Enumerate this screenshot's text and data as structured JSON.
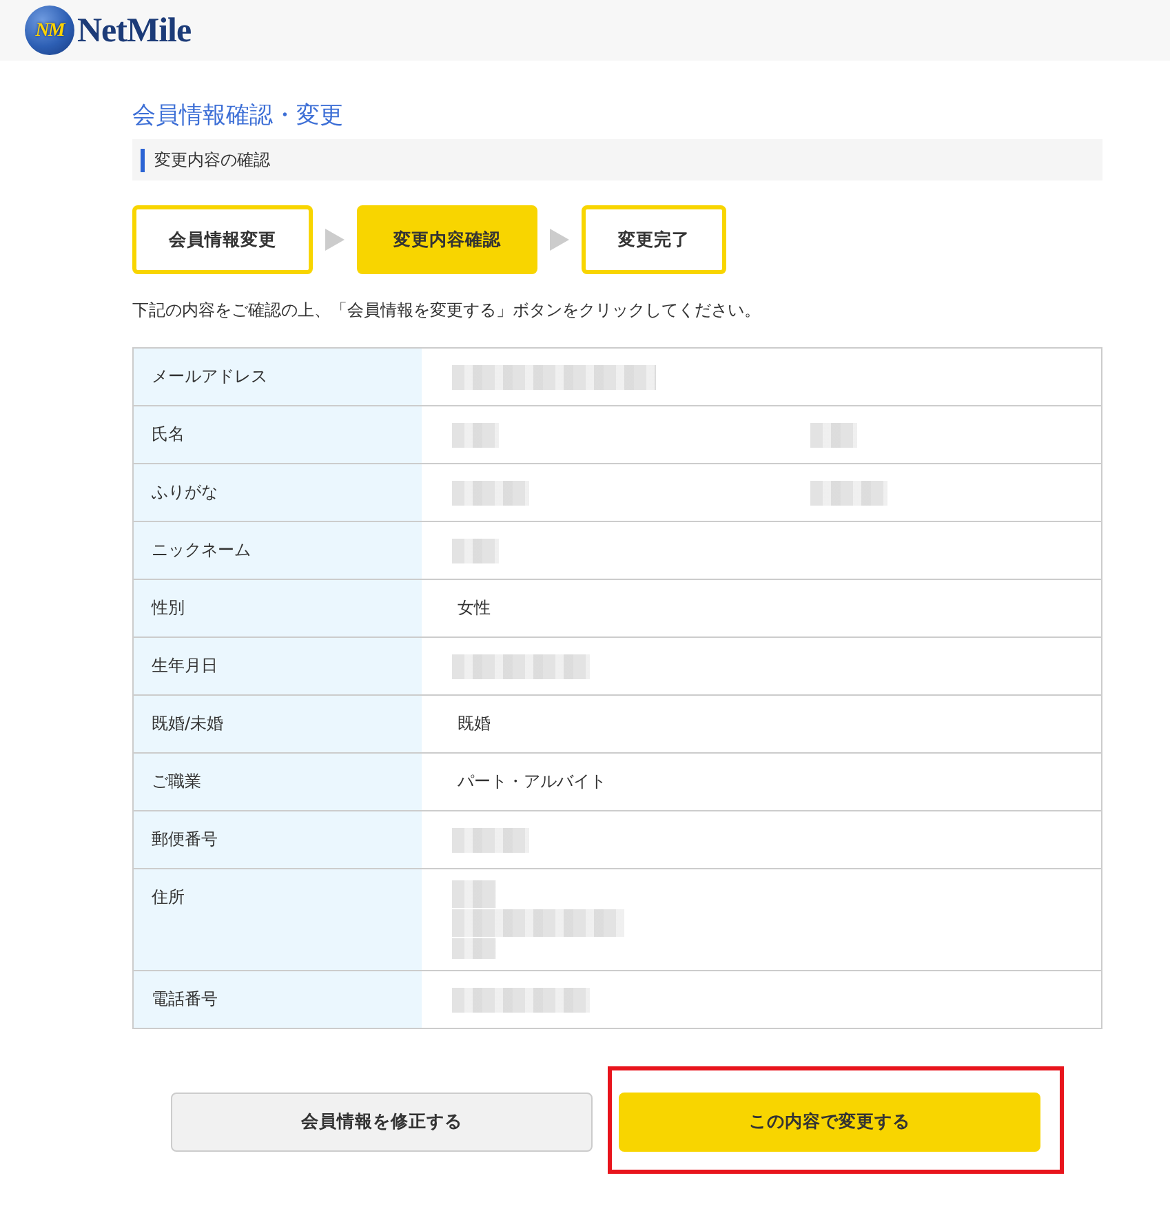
{
  "header": {
    "logo_mark": "NM",
    "logo_name": "NetMile"
  },
  "page_title": "会員情報確認・変更",
  "section_heading": "変更内容の確認",
  "steps": [
    {
      "label": "会員情報変更",
      "selected": false
    },
    {
      "label": "変更内容確認",
      "selected": true
    },
    {
      "label": "変更完了",
      "selected": false
    }
  ],
  "instruction": "下記の内容をご確認の上、「会員情報を変更する」ボタンをクリックしてください。",
  "table": {
    "rows": [
      {
        "label": "メールアドレス",
        "values": [
          {
            "kind": "blurwide"
          }
        ]
      },
      {
        "label": "氏名",
        "values": [
          {
            "kind": "blurtiny"
          },
          {
            "kind": "blurtiny"
          }
        ]
      },
      {
        "label": "ふりがな",
        "values": [
          {
            "kind": "blurshort"
          },
          {
            "kind": "blurshort"
          }
        ]
      },
      {
        "label": "ニックネーム",
        "values": [
          {
            "kind": "blurtiny"
          }
        ]
      },
      {
        "label": "性別",
        "values": [
          {
            "kind": "text",
            "text": "女性"
          }
        ]
      },
      {
        "label": "生年月日",
        "values": [
          {
            "kind": "blurlong"
          }
        ]
      },
      {
        "label": "既婚/未婚",
        "values": [
          {
            "kind": "text",
            "text": "既婚"
          }
        ]
      },
      {
        "label": "ご職業",
        "values": [
          {
            "kind": "text",
            "text": "パート・アルバイト"
          }
        ]
      },
      {
        "label": "郵便番号",
        "values": [
          {
            "kind": "blurshort"
          }
        ]
      },
      {
        "label": "住所",
        "values": [
          {
            "kind": "blurblock"
          }
        ]
      },
      {
        "label": "電話番号",
        "values": [
          {
            "kind": "blurlong"
          }
        ]
      }
    ]
  },
  "buttons": [
    {
      "label": "会員情報を修正する",
      "kind": "secondary",
      "highlighted": false
    },
    {
      "label": "この内容で変更する",
      "kind": "primary",
      "highlighted": true
    }
  ]
}
